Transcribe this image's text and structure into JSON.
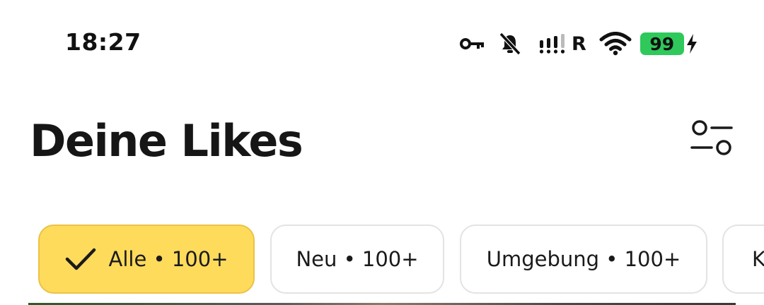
{
  "status_bar": {
    "time": "18:27",
    "network_label": "R",
    "battery_level": "99",
    "battery_color": "#2ec95a",
    "icons": [
      "vpn-key-icon",
      "mute-icon",
      "signal-icon",
      "wifi-icon",
      "battery-icon",
      "charging-bolt-icon"
    ]
  },
  "header": {
    "title": "Deine Likes",
    "filter_icon": "filter-sliders-icon"
  },
  "chips": [
    {
      "label": "Alle • 100+",
      "selected": true,
      "icon": "checkmark-icon"
    },
    {
      "label": "Neu • 100+",
      "selected": false
    },
    {
      "label": "Umgebung • 100+",
      "selected": false
    },
    {
      "label": "K",
      "selected": false
    }
  ],
  "colors": {
    "accent": "#ffdb5c",
    "accent_border": "#ebc246",
    "chip_border": "#e3e3e3",
    "text": "#1a1a1a"
  }
}
